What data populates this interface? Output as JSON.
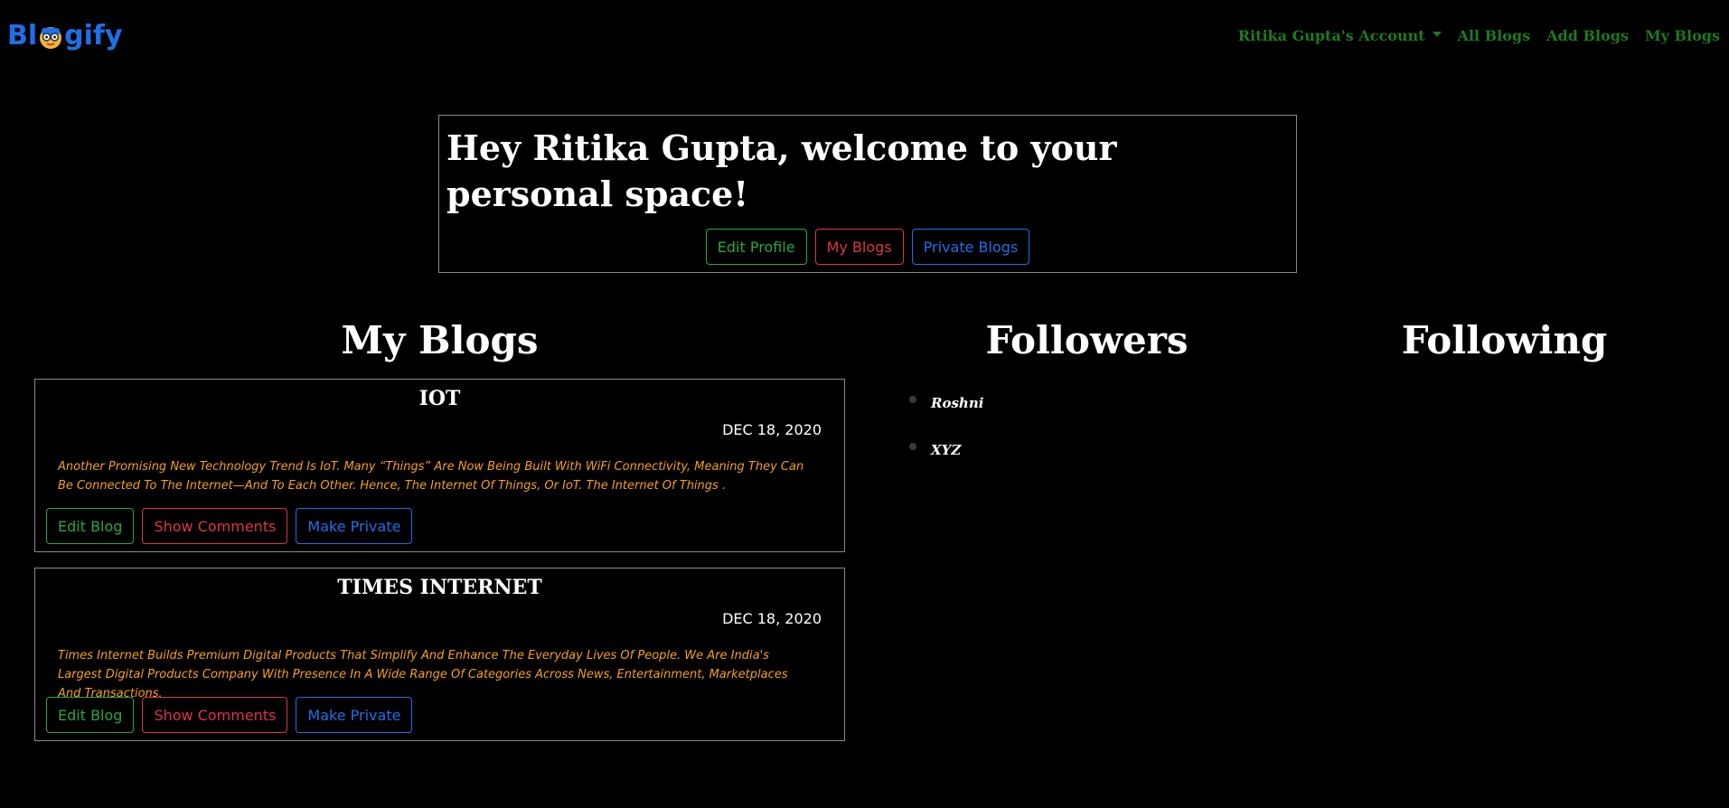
{
  "navbar": {
    "brand": {
      "before": "Bl",
      "after": "gify"
    },
    "account_label": "Ritika Gupta's Account",
    "links": [
      "All Blogs",
      "Add Blogs",
      "My Blogs"
    ]
  },
  "welcome": {
    "title": "Hey Ritika Gupta, welcome to your personal space!",
    "buttons": {
      "edit_profile": "Edit Profile",
      "my_blogs": "My Blogs",
      "private_blogs": "Private Blogs"
    }
  },
  "sections": {
    "my_blogs": "My Blogs",
    "followers": "Followers",
    "following": "Following"
  },
  "blogs": [
    {
      "title": "IOT",
      "date": "DEC 18, 2020",
      "text": "Another Promising New Technology Trend Is IoT. Many “Things” Are Now Being Built With WiFi Connectivity, Meaning They Can Be Connected To The Internet—And To Each Other. Hence, The Internet Of Things, Or IoT. The Internet Of Things .",
      "buttons": {
        "edit": "Edit Blog",
        "comments": "Show Comments",
        "private": "Make Private"
      }
    },
    {
      "title": "TIMES INTERNET",
      "date": "DEC 18, 2020",
      "text": "Times Internet Builds Premium Digital Products That Simplify And Enhance The Everyday Lives Of People. We Are India's Largest Digital Products Company With Presence In A Wide Range Of Categories Across News, Entertainment, Marketplaces And Transactions.",
      "buttons": {
        "edit": "Edit Blog",
        "comments": "Show Comments",
        "private": "Make Private"
      }
    }
  ],
  "followers": [
    "Roshni",
    "XYZ"
  ],
  "following": [],
  "colors": {
    "brand": "#1e6fe8",
    "nav": "#1d7a1d",
    "success": "#28a745",
    "danger": "#dc3545",
    "primary": "#1e6fe8",
    "blog_text": "#f5a017"
  }
}
